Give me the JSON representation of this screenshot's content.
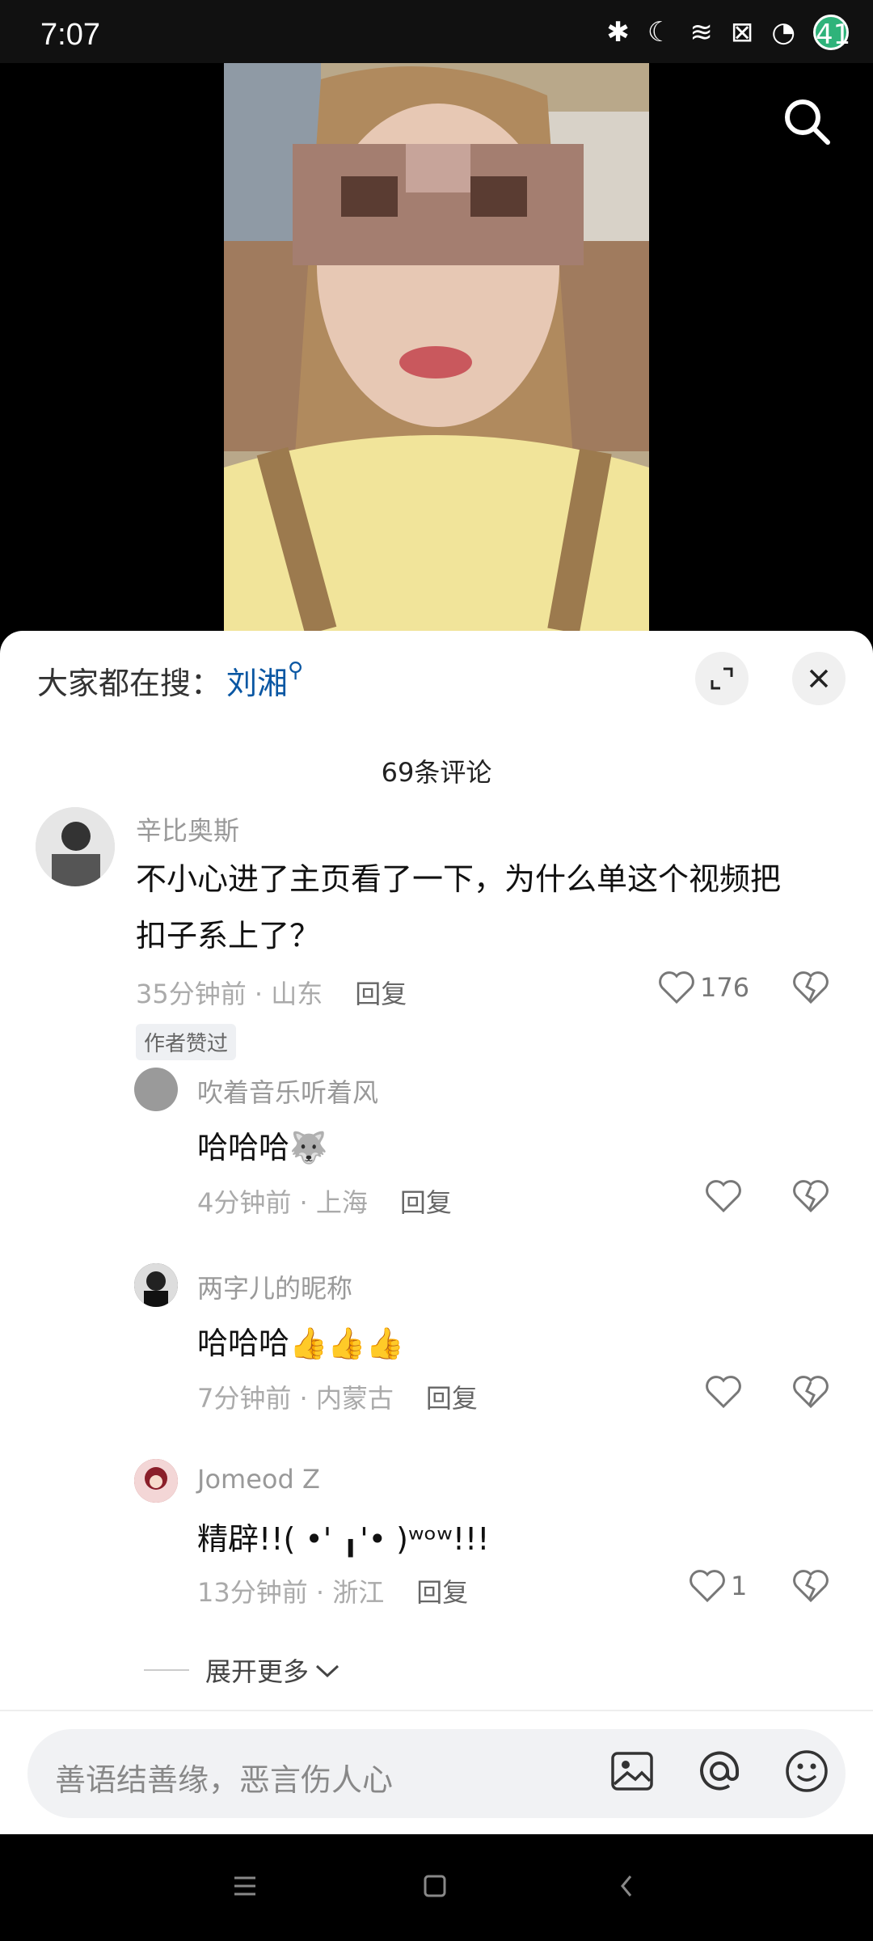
{
  "status_bar": {
    "time": "7:07",
    "battery": "41"
  },
  "sheet": {
    "hot_search_label": "大家都在搜：",
    "hot_search_term": "刘湘",
    "comment_count": "69条评论"
  },
  "comments": [
    {
      "name": "辛比奥斯",
      "content_line1": "不小心进了主页看了一下，为什么单这个视频把",
      "content_line2": "扣子系上了？",
      "time": "35分钟前",
      "location": "山东",
      "reply": "回复",
      "likes": "176",
      "tag": "作者赞过"
    }
  ],
  "replies": [
    {
      "name": "吹着音乐听着风",
      "content": "哈哈哈",
      "emoji": "🐺",
      "time": "4分钟前",
      "location": "上海",
      "reply": "回复",
      "likes": ""
    },
    {
      "name": "两字儿的昵称",
      "content": "哈哈哈",
      "emoji": "👍👍👍",
      "time": "7分钟前",
      "location": "内蒙古",
      "reply": "回复",
      "likes": ""
    },
    {
      "name": "Jomeod Z",
      "content": "精辟!!( •' ╻'• )ʷᵒʷ!!!",
      "emoji": "",
      "time": "13分钟前",
      "location": "浙江",
      "reply": "回复",
      "likes": "1"
    }
  ],
  "expand_more": "展开更多",
  "input": {
    "placeholder": "善语结善缘，恶言伤人心"
  },
  "icons": [
    "search-icon",
    "expand-icon",
    "close-icon",
    "heart-icon",
    "dislike-icon",
    "image-icon",
    "at-icon",
    "emoji-icon",
    "menu-icon",
    "home-icon",
    "back-icon"
  ]
}
